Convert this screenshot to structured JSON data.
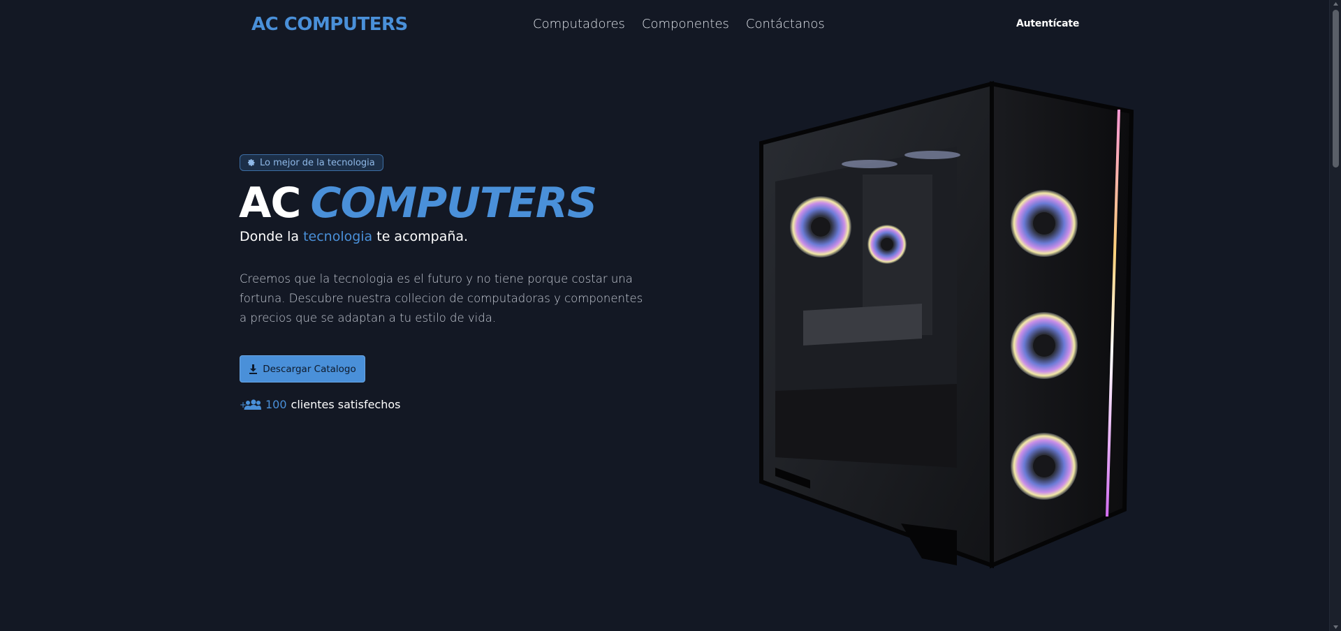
{
  "brand": {
    "logo": "AC COMPUTERS",
    "accent": "#4a90d9",
    "background": "#131824"
  },
  "nav": {
    "links": [
      "Computadores",
      "Componentes",
      "Contáctanos"
    ],
    "auth_label": "Autentícate"
  },
  "hero": {
    "badge": {
      "icon": "gear-icon",
      "label": "Lo mejor de la tecnologia"
    },
    "title_white": "AC",
    "title_blue": "COMPUTERS",
    "subtitle_pre": "Donde la ",
    "subtitle_highlight": "tecnologia",
    "subtitle_post": " te acompaña.",
    "description": "Creemos que la tecnologia es el futuro y no tiene porque costar una fortuna. Descubre nuestra collecion de computadoras y componentes a precios que se adaptan a tu estilo de vida.",
    "button": {
      "icon": "download-icon",
      "label": "Descargar Catalogo"
    },
    "clients": {
      "icon": "users-plus-icon",
      "count": "100",
      "label": " clientes satisfechos"
    }
  },
  "image": {
    "subject": "pc-case-with-rgb-fans"
  }
}
